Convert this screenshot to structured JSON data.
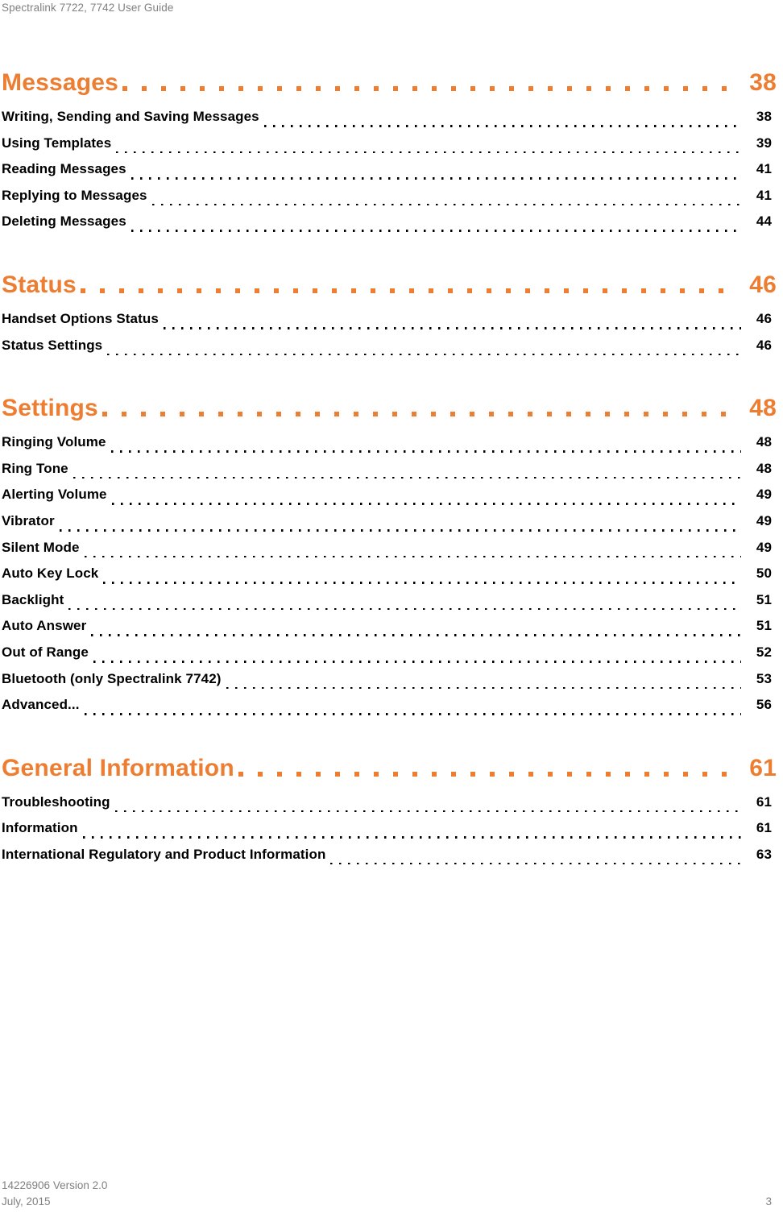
{
  "header": {
    "running_title": "Spectralink 7722, 7742 User Guide"
  },
  "colors": {
    "accent_orange": "#ED7D31",
    "body_text": "#000000",
    "muted_gray": "#808080"
  },
  "toc": {
    "groups": [
      {
        "section": {
          "title": "Messages",
          "page": "38"
        },
        "entries": [
          {
            "title": "Writing, Sending and Saving Messages",
            "page": "38"
          },
          {
            "title": "Using Templates",
            "page": "39"
          },
          {
            "title": "Reading Messages",
            "page": "41"
          },
          {
            "title": "Replying to Messages",
            "page": "41"
          },
          {
            "title": "Deleting Messages",
            "page": "44"
          }
        ]
      },
      {
        "section": {
          "title": "Status",
          "page": "46"
        },
        "entries": [
          {
            "title": "Handset Options Status",
            "page": "46"
          },
          {
            "title": "Status Settings",
            "page": "46"
          }
        ]
      },
      {
        "section": {
          "title": "Settings",
          "page": "48"
        },
        "entries": [
          {
            "title": "Ringing Volume",
            "page": "48"
          },
          {
            "title": "Ring Tone",
            "page": "48"
          },
          {
            "title": "Alerting Volume",
            "page": "49"
          },
          {
            "title": "Vibrator",
            "page": "49"
          },
          {
            "title": "Silent Mode",
            "page": "49"
          },
          {
            "title": "Auto Key Lock",
            "page": "50"
          },
          {
            "title": "Backlight",
            "page": "51"
          },
          {
            "title": "Auto Answer",
            "page": "51"
          },
          {
            "title": "Out of Range",
            "page": "52"
          },
          {
            "title": "Bluetooth (only Spectralink 7742)",
            "page": "53"
          },
          {
            "title": "Advanced...",
            "page": "56"
          }
        ]
      },
      {
        "section": {
          "title": "General Information",
          "page": "61"
        },
        "entries": [
          {
            "title": "Troubleshooting",
            "page": "61"
          },
          {
            "title": "Information",
            "page": "61"
          },
          {
            "title": "International Regulatory and Product Information",
            "page": "63"
          }
        ]
      }
    ]
  },
  "footer": {
    "document_number": "14226906 Version 2.0",
    "date": "July, 2015",
    "page_number": "3"
  }
}
